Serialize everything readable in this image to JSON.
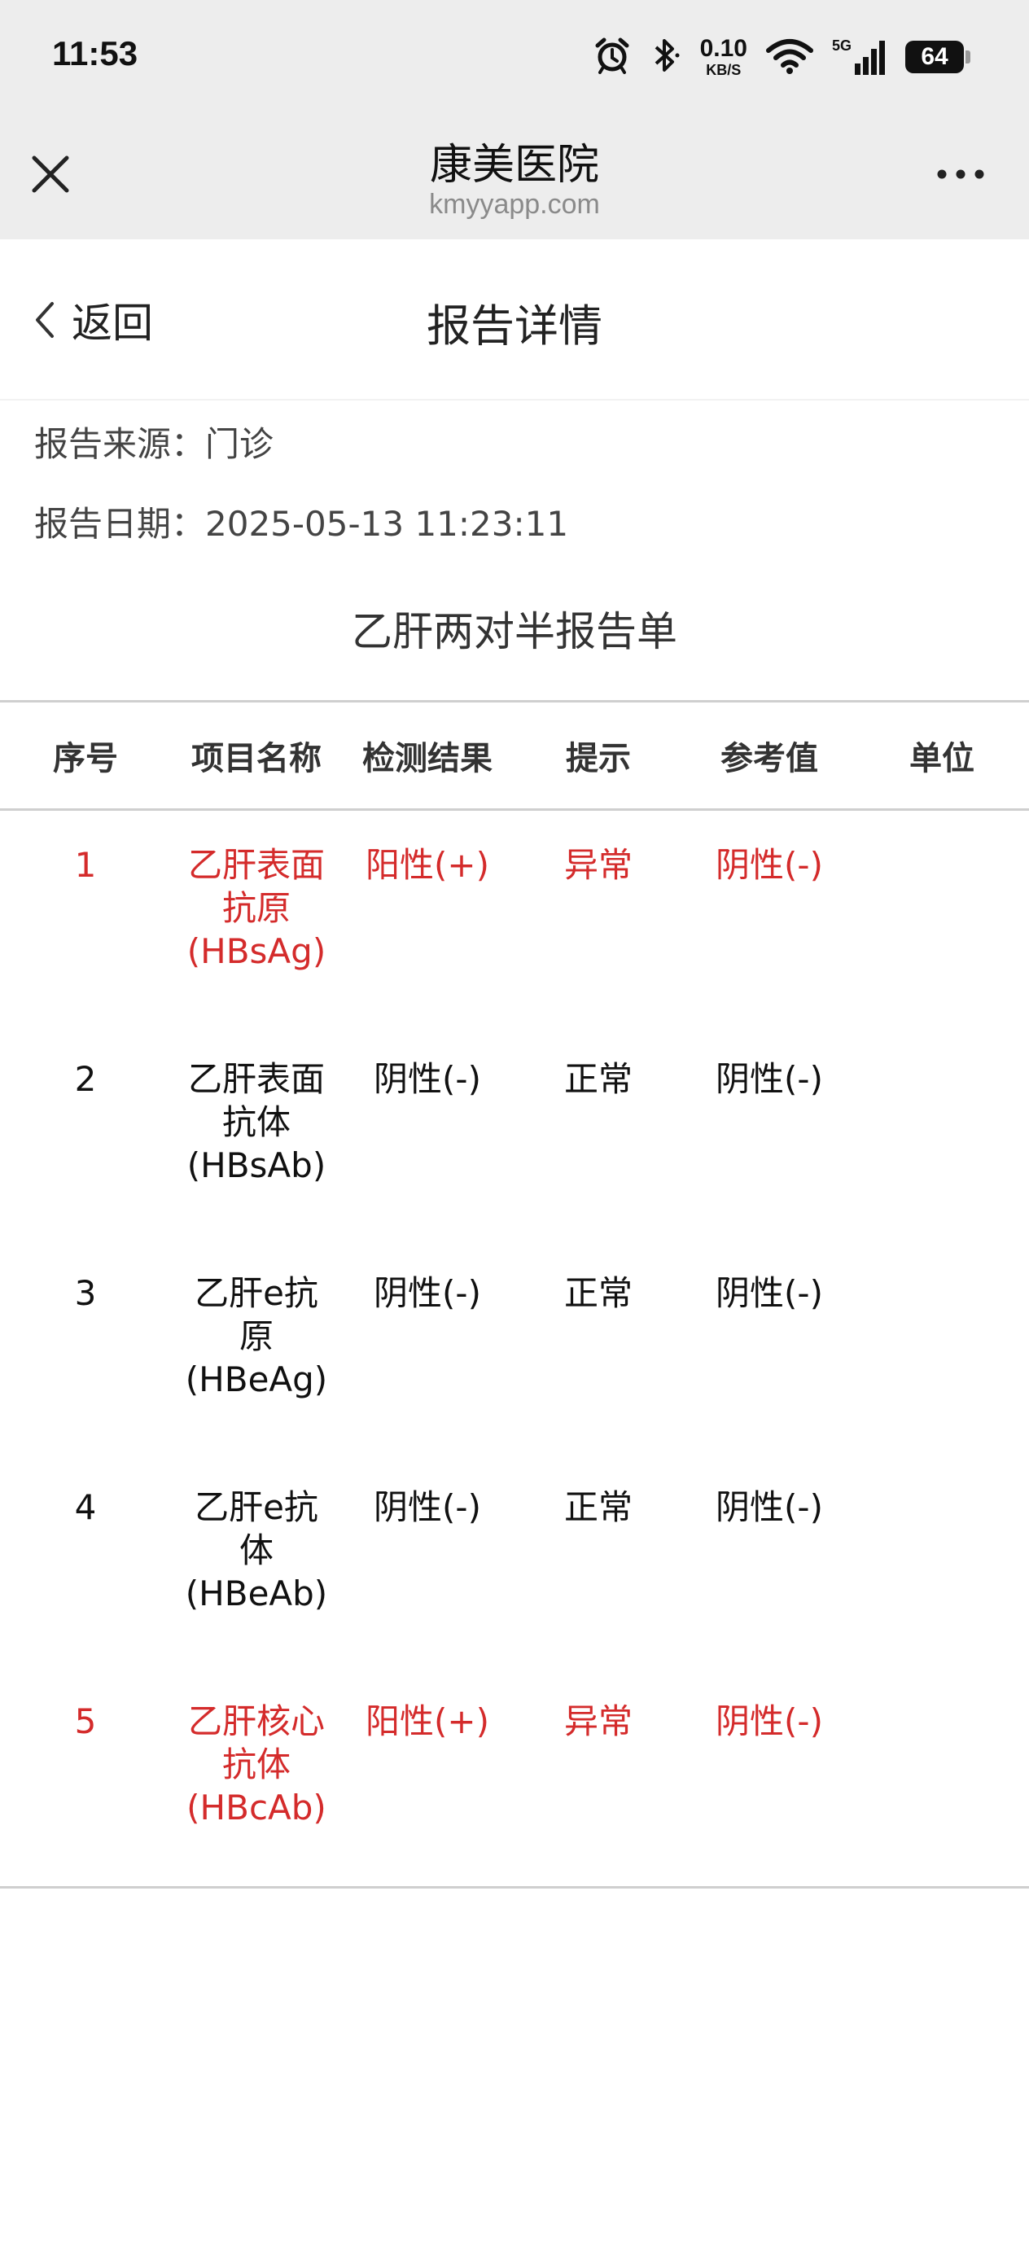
{
  "status_bar": {
    "time": "11:53",
    "net_speed": "0.10",
    "net_unit": "KB/S",
    "signal_label": "5G",
    "battery": "64",
    "icons": [
      "alarm-icon",
      "bluetooth-icon",
      "wifi-icon",
      "cellular-signal-icon",
      "battery-icon"
    ]
  },
  "browser_bar": {
    "close_icon": "close-icon",
    "site_name": "康美医院",
    "site_domain": "kmyyapp.com",
    "more_icon": "more-icon"
  },
  "page_header": {
    "back_label": "返回",
    "back_icon": "chevron-left-icon",
    "title": "报告详情"
  },
  "report_meta": {
    "source_label": "报告来源：",
    "source_value": "门诊",
    "date_label": "报告日期：",
    "date_value": "2025-05-13 11:23:11"
  },
  "report": {
    "title": "乙肝两对半报告单",
    "columns": [
      "序号",
      "项目名称",
      "检测结果",
      "提示",
      "参考值",
      "单位"
    ],
    "rows": [
      {
        "no": "1",
        "item": "乙肝表面抗原(HBsAg)",
        "result": "阳性(+)",
        "hint": "异常",
        "reference": "阴性(-)",
        "unit": "",
        "abnormal": true
      },
      {
        "no": "2",
        "item": "乙肝表面抗体(HBsAb)",
        "result": "阴性(-)",
        "hint": "正常",
        "reference": "阴性(-)",
        "unit": "",
        "abnormal": false
      },
      {
        "no": "3",
        "item": "乙肝e抗原(HBeAg)",
        "result": "阴性(-)",
        "hint": "正常",
        "reference": "阴性(-)",
        "unit": "",
        "abnormal": false
      },
      {
        "no": "4",
        "item": "乙肝e抗体(HBeAb)",
        "result": "阴性(-)",
        "hint": "正常",
        "reference": "阴性(-)",
        "unit": "",
        "abnormal": false
      },
      {
        "no": "5",
        "item": "乙肝核心抗体(HBcAb)",
        "result": "阳性(+)",
        "hint": "异常",
        "reference": "阴性(-)",
        "unit": "",
        "abnormal": true
      }
    ]
  },
  "colors": {
    "abnormal_text": "#d42b2b",
    "normal_text": "#111111",
    "bar_background": "#ededed",
    "divider": "#cfcfcf"
  }
}
